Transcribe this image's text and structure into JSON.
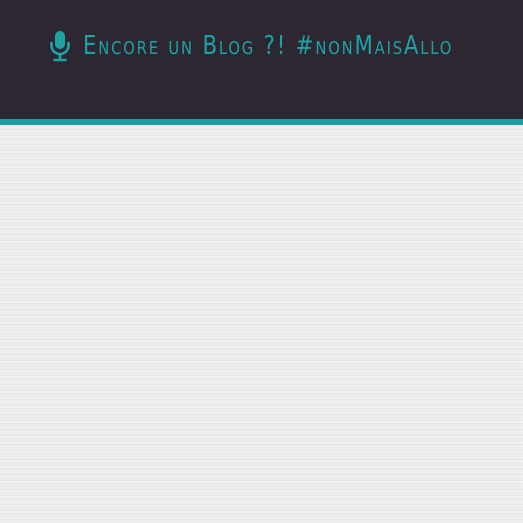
{
  "header": {
    "title": "Encore un Blog ?! #nonMaisAllo",
    "icon": "microphone-icon",
    "background_color": "#2d2731",
    "accent_color": "#1da3a6"
  },
  "page": {
    "background_color": "#f1f1f1"
  }
}
